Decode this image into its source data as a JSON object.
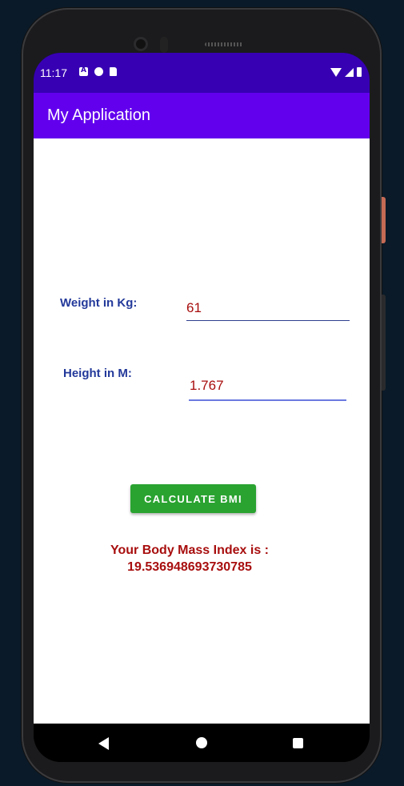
{
  "status_bar": {
    "time": "11:17",
    "left_icons": [
      "a-notification-icon",
      "dnd-icon",
      "sd-card-icon"
    ],
    "right_icons": [
      "wifi-icon",
      "signal-icon",
      "battery-icon"
    ]
  },
  "app_bar": {
    "title": "My Application",
    "color": "#6200ee",
    "status_color": "#3700b3"
  },
  "form": {
    "weight_label": "Weight  in Kg:",
    "weight_value": "61",
    "height_label": "Height in M:",
    "height_value": "1.767"
  },
  "button": {
    "label": "Calculate BMI",
    "color": "#2aa331"
  },
  "result": {
    "line1": "Your Body Mass Index is :",
    "line2": "19.536948693730785"
  },
  "nav_bar": {
    "icons": [
      "back-icon",
      "home-icon",
      "recents-icon"
    ]
  }
}
